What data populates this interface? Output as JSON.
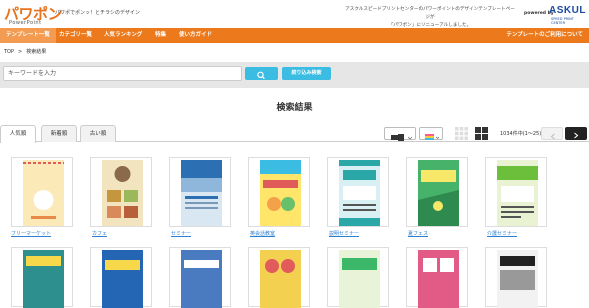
{
  "header": {
    "logo": "パワポン",
    "logo_sub": "PowerPoint",
    "tagline": "パワポでポンッ！とチラシのデザイン",
    "notice_line1": "アスクルスピードプリントセンターのパワーポイントのデザインテンプレートページが",
    "notice_line2": "「パワポン」にリニューアルしました。",
    "powered_by": "powered by",
    "brand": "ASKUL",
    "brand_sub": "SPEED PRINT CENTER"
  },
  "nav": {
    "items": [
      "テンプレート一覧",
      "カテゴリ一覧",
      "人気ランキング",
      "特集",
      "使い方ガイド"
    ],
    "right": "テンプレートのご利用について"
  },
  "breadcrumb": [
    "TOP",
    ">",
    "検索結果"
  ],
  "search": {
    "placeholder": "キーワードを入力",
    "filter_label": "絞り込み検索"
  },
  "results": {
    "title": "検索結果",
    "tabs": [
      "人気順",
      "新着順",
      "古い順"
    ],
    "count": "1034件中(1〜25)"
  },
  "templates": [
    {
      "label": "フリーマーケット",
      "color": "#fce9b8"
    },
    {
      "label": "カフェ",
      "color": "#f3e4c0"
    },
    {
      "label": "セミナー",
      "color": "#d9e7f3"
    },
    {
      "label": "英会話教室",
      "color": "#ffe56a"
    },
    {
      "label": "説明セミナー",
      "color": "#d8f0f4"
    },
    {
      "label": "夏フェス",
      "color": "#47b26a"
    },
    {
      "label": "介護セミナー",
      "color": "#e9f3d4"
    }
  ],
  "templates_row2": [
    {
      "color": "#2e8f8f"
    },
    {
      "color": "#2466b3"
    },
    {
      "color": "#4a7ac0"
    },
    {
      "color": "#f3d050"
    },
    {
      "color": "#e8f3d8"
    },
    {
      "color": "#e25b86"
    },
    {
      "color": "#f2f2f2"
    }
  ],
  "colors": {
    "accent": "#ec7a1c",
    "button": "#3bbde3",
    "link": "#2a7fd0"
  }
}
